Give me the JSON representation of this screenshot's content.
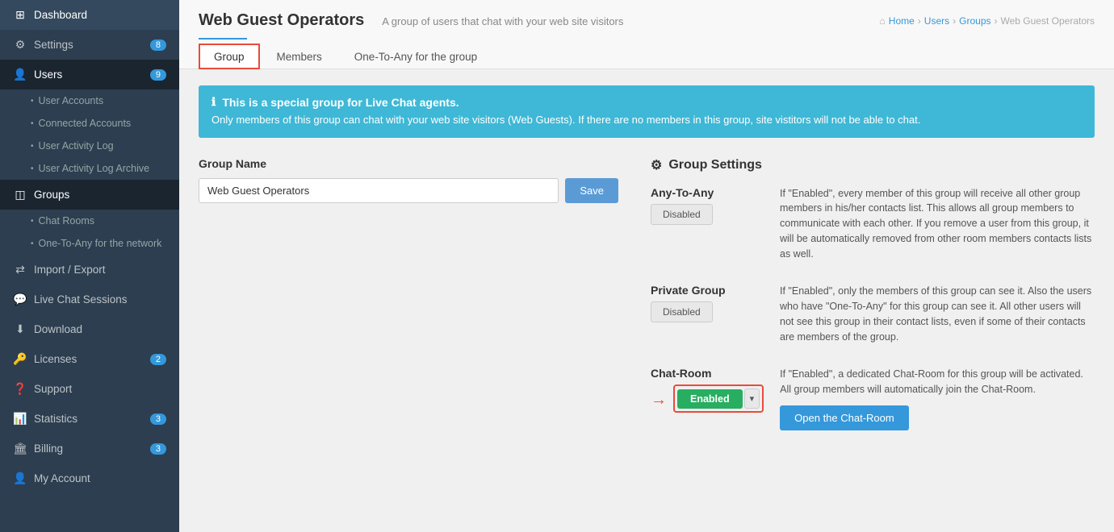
{
  "sidebar": {
    "items": [
      {
        "id": "dashboard",
        "label": "Dashboard",
        "icon": "⊞",
        "badge": null
      },
      {
        "id": "settings",
        "label": "Settings",
        "icon": "⚙",
        "badge": "8"
      },
      {
        "id": "users",
        "label": "Users",
        "icon": "👤",
        "badge": "9",
        "active": true
      },
      {
        "id": "user-accounts",
        "label": "User Accounts",
        "icon": "•",
        "sub": true
      },
      {
        "id": "connected-accounts",
        "label": "Connected Accounts",
        "icon": "•",
        "sub": true
      },
      {
        "id": "user-activity-log",
        "label": "User Activity Log",
        "icon": "•",
        "sub": true
      },
      {
        "id": "user-activity-log-archive",
        "label": "User Activity Log Archive",
        "icon": "•",
        "sub": true
      },
      {
        "id": "groups",
        "label": "Groups",
        "icon": "◫",
        "active": true
      },
      {
        "id": "chat-rooms",
        "label": "Chat Rooms",
        "icon": "💬",
        "sub": true
      },
      {
        "id": "one-to-any-network",
        "label": "One-To-Any for the network",
        "icon": "•",
        "sub": true
      },
      {
        "id": "import-export",
        "label": "Import / Export",
        "icon": "⇄"
      },
      {
        "id": "live-chat-sessions",
        "label": "Live Chat Sessions",
        "icon": "💬"
      },
      {
        "id": "download",
        "label": "Download",
        "icon": "⬇"
      },
      {
        "id": "licenses",
        "label": "Licenses",
        "icon": "🔑",
        "badge": "2"
      },
      {
        "id": "support",
        "label": "Support",
        "icon": "❓"
      },
      {
        "id": "statistics",
        "label": "Statistics",
        "icon": "📊",
        "badge": "3"
      },
      {
        "id": "billing",
        "label": "Billing",
        "icon": "🏛",
        "badge": "3"
      },
      {
        "id": "my-account",
        "label": "My Account",
        "icon": "👤"
      }
    ]
  },
  "header": {
    "title": "Web Guest Operators",
    "subtitle": "A group of users that chat with your web site visitors",
    "breadcrumb": [
      "Home",
      "Users",
      "Groups",
      "Web Guest Operators"
    ],
    "breadcrumb_icon": "⌂"
  },
  "tabs": [
    {
      "id": "group",
      "label": "Group",
      "active": true
    },
    {
      "id": "members",
      "label": "Members",
      "active": false
    },
    {
      "id": "one-to-any",
      "label": "One-To-Any for the group",
      "active": false
    }
  ],
  "banner": {
    "icon": "ℹ",
    "title": "This is a special group for Live Chat agents.",
    "text": "Only members of this group can chat with your web site visitors (Web Guests). If there are no members in this group, site vistitors will not be able to chat."
  },
  "group_name_section": {
    "label": "Group Name",
    "value": "Web Guest Operators",
    "save_button": "Save"
  },
  "settings_section": {
    "title": "Group Settings",
    "icon": "⚙",
    "items": [
      {
        "id": "any-to-any",
        "name": "Any-To-Any",
        "button_label": "Disabled",
        "description": "If \"Enabled\", every member of this group will receive all other group members in his/her contacts list. This allows all group members to communicate with each other. If you remove a user from this group, it will be automatically removed from other room members contacts lists as well."
      },
      {
        "id": "private-group",
        "name": "Private Group",
        "button_label": "Disabled",
        "description": "If \"Enabled\", only the members of this group can see it. Also the users who have \"One-To-Any\" for this group can see it. All other users will not see this group in their contact lists, even if some of their contacts are members of the group."
      },
      {
        "id": "chat-room",
        "name": "Chat-Room",
        "button_label": "Enabled",
        "description": "If \"Enabled\", a dedicated Chat-Room for this group will be activated. All group members will automatically join the Chat-Room.",
        "open_button": "Open the Chat-Room",
        "highlighted": true
      }
    ]
  }
}
